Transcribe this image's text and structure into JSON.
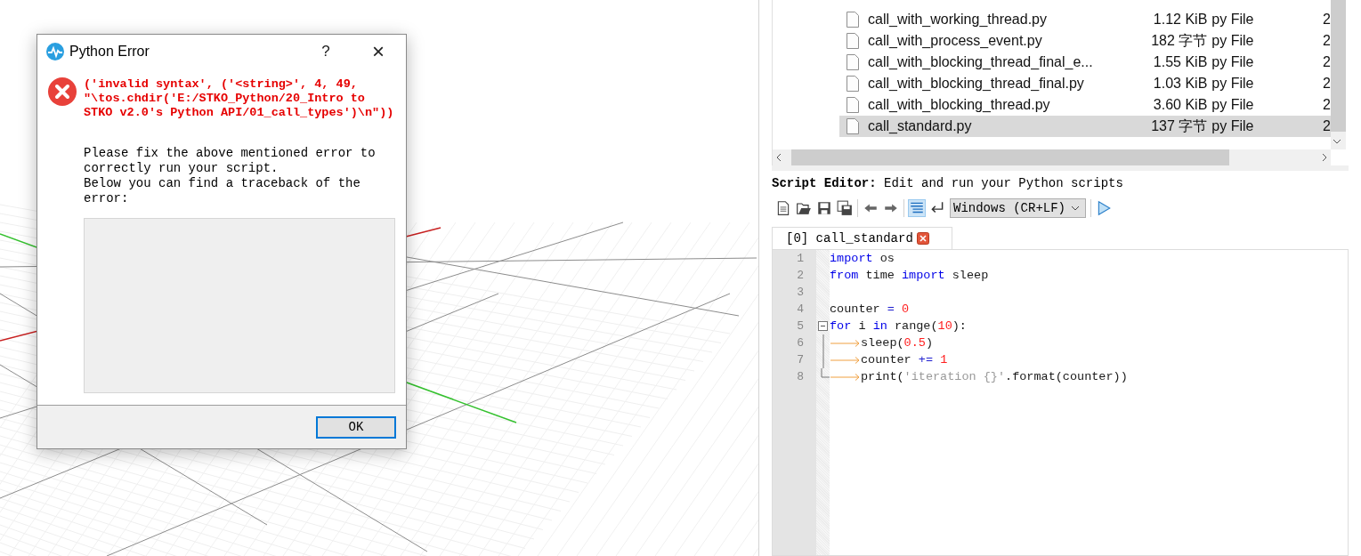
{
  "dialog": {
    "title": "Python Error",
    "help": "?",
    "close": "×",
    "error_message": "('invalid syntax', ('<string>', 4, 49, \"\\tos.chdir('E:/STKO_Python/20_Intro to STKO v2.0's Python API/01_call_types')\\n\"))",
    "paragraphs": [
      "Please fix the above mentioned error to correctly run your script.",
      "Below you can find a traceback of the error:"
    ],
    "button": "OK"
  },
  "files": [
    {
      "name": "call_with_working_thread.py",
      "size": "1.12 KiB",
      "type": "py File",
      "column_4": "2",
      "selected": false
    },
    {
      "name": "call_with_process_event.py",
      "size": "182 字节",
      "type": "py File",
      "column_4": "2",
      "selected": false
    },
    {
      "name": "call_with_blocking_thread_final_e...",
      "size": "1.55 KiB",
      "type": "py File",
      "column_4": "2",
      "selected": false
    },
    {
      "name": "call_with_blocking_thread_final.py",
      "size": "1.03 KiB",
      "type": "py File",
      "column_4": "2",
      "selected": false
    },
    {
      "name": "call_with_blocking_thread.py",
      "size": "3.60 KiB",
      "type": "py File",
      "column_4": "2",
      "selected": false
    },
    {
      "name": "call_standard.py",
      "size": "137 字节",
      "type": "py File",
      "column_4": "2",
      "selected": true
    }
  ],
  "editor": {
    "heading": "**Script Editor:** Edit and run your Python scripts",
    "toolbar_groups": [
      [
        {
          "kind": "new",
          "selected": false
        },
        {
          "kind": "open",
          "selected": false
        },
        {
          "kind": "save",
          "selected": false
        },
        {
          "kind": "saveall",
          "selected": false
        }
      ],
      [
        {
          "kind": "back",
          "selected": false
        },
        {
          "kind": "forward",
          "selected": false
        }
      ],
      [
        {
          "kind": "wrap",
          "selected": true
        },
        {
          "kind": "enter",
          "selected": false
        }
      ]
    ],
    "line_ending": "Windows (CR+LF)",
    "tabs": [
      {
        "label": "[0] call_standard",
        "selected": true
      }
    ],
    "lines": [
      {
        "number": "1",
        "kind": "plain",
        "tokens": [
          {
            "kind": "keyword",
            "text": "import"
          },
          {
            "kind": "plain",
            "text": " os"
          }
        ]
      },
      {
        "number": "2",
        "kind": "plain",
        "tokens": [
          {
            "kind": "keyword",
            "text": "from"
          },
          {
            "kind": "plain",
            "text": " time "
          },
          {
            "kind": "keyword",
            "text": "import"
          },
          {
            "kind": "plain",
            "text": " sleep"
          }
        ]
      },
      {
        "number": "3",
        "kind": "plain"
      },
      {
        "number": "4",
        "kind": "plain",
        "tokens": [
          {
            "kind": "plain",
            "text": "counter "
          },
          {
            "kind": "operator",
            "text": "= "
          },
          {
            "kind": "number",
            "text": "0"
          }
        ]
      },
      {
        "number": "5",
        "kind": "fold_start",
        "tokens": [
          {
            "kind": "keyword",
            "text": "for"
          },
          {
            "kind": "plain",
            "text": " i "
          },
          {
            "kind": "keyword",
            "text": "in"
          },
          {
            "kind": "plain",
            "text": " range("
          },
          {
            "kind": "number",
            "text": "10"
          },
          {
            "kind": "plain",
            "text": "):"
          }
        ]
      },
      {
        "number": "6",
        "kind": "fold_body",
        "tokens": [
          {
            "kind": "tab"
          },
          {
            "kind": "plain",
            "text": "sleep("
          },
          {
            "kind": "number",
            "text": "0.5"
          },
          {
            "kind": "plain",
            "text": ")"
          }
        ]
      },
      {
        "number": "7",
        "kind": "fold_body",
        "tokens": [
          {
            "kind": "tab"
          },
          {
            "kind": "plain",
            "text": "counter "
          },
          {
            "kind": "operator",
            "text": "+= "
          },
          {
            "kind": "number",
            "text": "1"
          }
        ]
      },
      {
        "number": "8",
        "kind": "fold_end",
        "tokens": [
          {
            "kind": "tab"
          },
          {
            "kind": "plain",
            "text": "print("
          },
          {
            "kind": "string",
            "text": "'iteration {}'"
          },
          {
            "kind": "plain",
            "text": ".format(counter))"
          }
        ]
      }
    ]
  }
}
